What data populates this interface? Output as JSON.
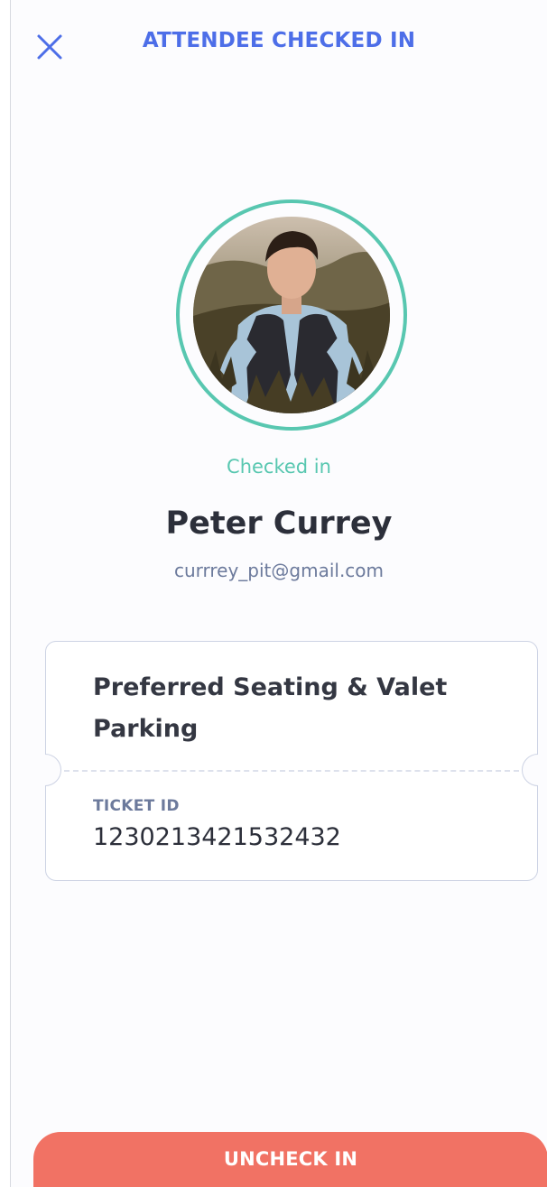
{
  "header": {
    "title": "ATTENDEE CHECKED IN",
    "close_icon": "close-icon"
  },
  "attendee": {
    "status": "Checked in",
    "name": "Peter Currey",
    "email": "currrey_pit@gmail.com"
  },
  "ticket": {
    "type": "Preferred Seating & Valet Parking",
    "id_label": "TICKET ID",
    "id_value": "1230213421532432"
  },
  "actions": {
    "uncheck_label": "UNCHECK IN"
  },
  "colors": {
    "accent_blue": "#4d6ee8",
    "checked_green": "#58c7b0",
    "button_coral": "#f17264",
    "text_dark": "#2c2f3a",
    "text_muted": "#6c7a9c"
  }
}
